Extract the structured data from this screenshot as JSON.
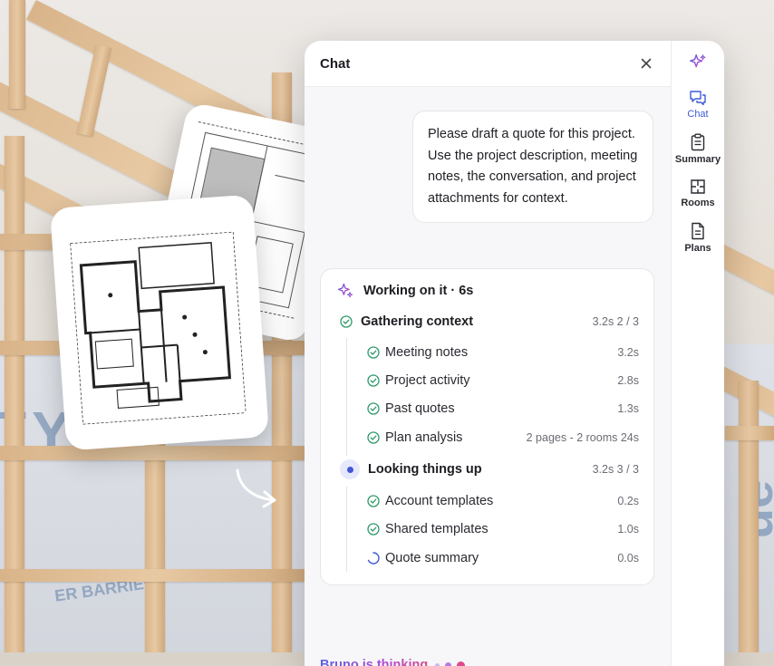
{
  "chat": {
    "title": "Chat",
    "close_label": "×",
    "user_message": "Please draft a quote for this project. Use the project description, meeting notes, the conversation, and project attachments for context.",
    "working": {
      "title": "Working on it · 6s",
      "groups": [
        {
          "title": "Gathering context",
          "meta": "3.2s 2 / 3",
          "state": "done",
          "steps": [
            {
              "label": "Meeting notes",
              "meta": "3.2s",
              "state": "done"
            },
            {
              "label": "Project activity",
              "meta": "2.8s",
              "state": "done"
            },
            {
              "label": "Past quotes",
              "meta": "1.3s",
              "state": "done"
            },
            {
              "label": "Plan analysis",
              "meta": "2 pages - 2 rooms 24s",
              "state": "done"
            }
          ]
        },
        {
          "title": "Looking things up",
          "meta": "3.2s 3 / 3",
          "state": "active",
          "steps": [
            {
              "label": "Account templates",
              "meta": "0.2s",
              "state": "done"
            },
            {
              "label": "Shared templates",
              "meta": "1.0s",
              "state": "done"
            },
            {
              "label": "Quote summary",
              "meta": "0.0s",
              "state": "loading"
            }
          ]
        }
      ]
    },
    "thinking_text": "Bruno is thinking"
  },
  "side_nav": {
    "top_icon": "sparkle-icon",
    "items": [
      {
        "label": "Chat",
        "icon": "chat-bubbles-icon",
        "active": true
      },
      {
        "label": "Summary",
        "icon": "clipboard-icon",
        "active": false
      },
      {
        "label": "Rooms",
        "icon": "floorplan-icon",
        "active": false
      },
      {
        "label": "Plans",
        "icon": "document-icon",
        "active": false
      }
    ]
  },
  "background": {
    "wrap_text_left": "TYV",
    "wrap_text_bottom": "ER BARRIER",
    "wrap_text_right": "ue"
  },
  "colors": {
    "accent_blue": "#3f5bd8",
    "check_green": "#2f9a6a",
    "sparkle_purple": "#8a4fe0",
    "thinking_gradient": [
      "#5d63e0",
      "#b04bd3",
      "#d84a86"
    ]
  }
}
